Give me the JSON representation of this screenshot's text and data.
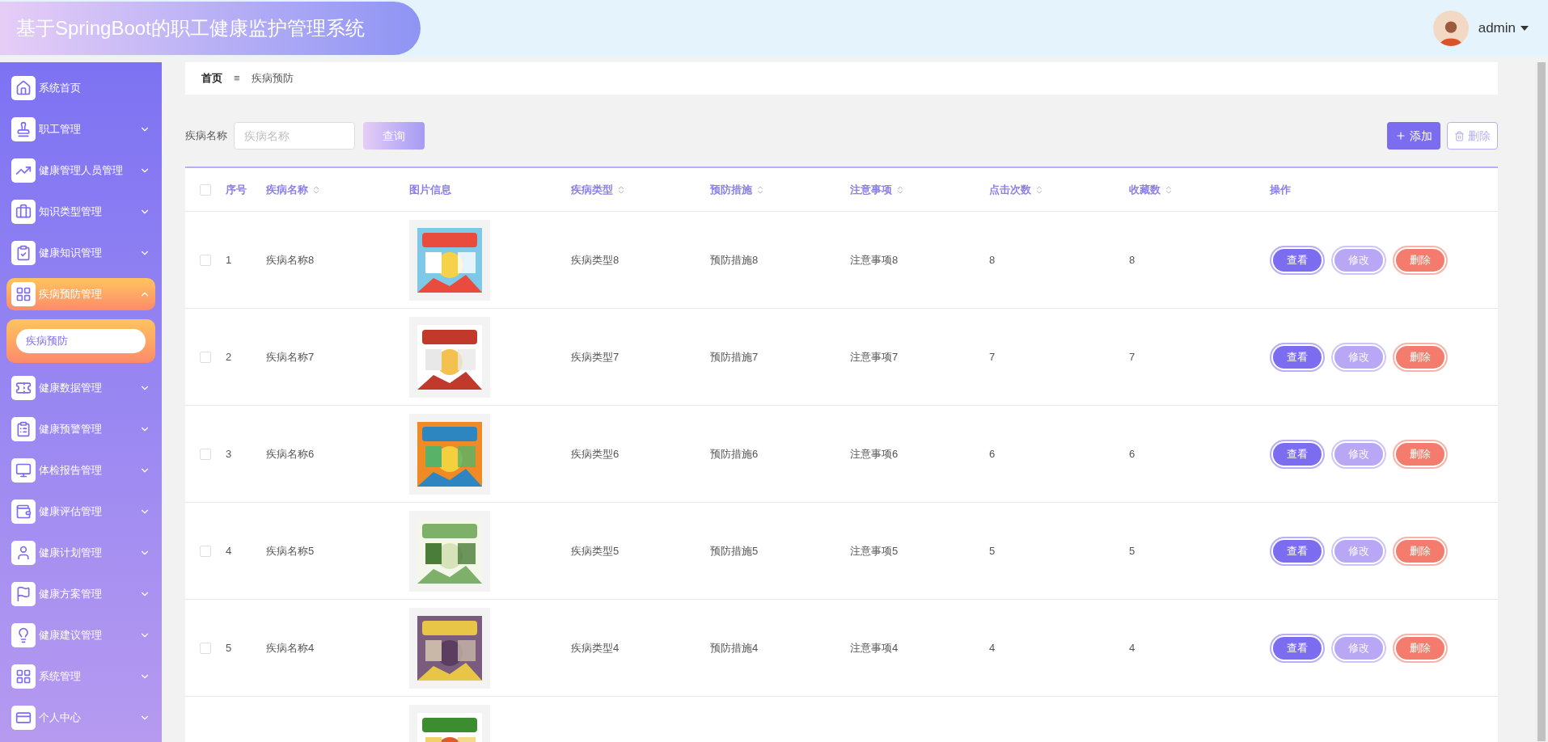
{
  "header": {
    "title": "基于SpringBoot的职工健康监护管理系统",
    "user": "admin"
  },
  "sidebar": {
    "items": [
      {
        "label": "系统首页",
        "kind": "link"
      },
      {
        "label": "职工管理",
        "kind": "menu",
        "expanded": false
      },
      {
        "label": "健康管理人员管理",
        "kind": "menu",
        "expanded": false
      },
      {
        "label": "知识类型管理",
        "kind": "menu",
        "expanded": false
      },
      {
        "label": "健康知识管理",
        "kind": "menu",
        "expanded": false
      },
      {
        "label": "疾病预防管理",
        "kind": "menu",
        "expanded": true,
        "children": [
          {
            "label": "疾病预防",
            "selected": true
          }
        ]
      },
      {
        "label": "健康数据管理",
        "kind": "menu",
        "expanded": false
      },
      {
        "label": "健康预警管理",
        "kind": "menu",
        "expanded": false
      },
      {
        "label": "体检报告管理",
        "kind": "menu",
        "expanded": false
      },
      {
        "label": "健康评估管理",
        "kind": "menu",
        "expanded": false
      },
      {
        "label": "健康计划管理",
        "kind": "menu",
        "expanded": false
      },
      {
        "label": "健康方案管理",
        "kind": "menu",
        "expanded": false
      },
      {
        "label": "健康建议管理",
        "kind": "menu",
        "expanded": false
      },
      {
        "label": "系统管理",
        "kind": "menu",
        "expanded": false
      },
      {
        "label": "个人中心",
        "kind": "menu",
        "expanded": false
      }
    ]
  },
  "breadcrumb": {
    "home": "首页",
    "separator": "≡",
    "current": "疾病预防"
  },
  "search": {
    "label": "疾病名称",
    "placeholder": "疾病名称",
    "button": "查询"
  },
  "actions": {
    "add": "添加",
    "delete": "删除"
  },
  "table": {
    "columns": [
      {
        "label": "序号",
        "sortable": false
      },
      {
        "label": "疾病名称",
        "sortable": true
      },
      {
        "label": "图片信息",
        "sortable": false
      },
      {
        "label": "疾病类型",
        "sortable": true
      },
      {
        "label": "预防措施",
        "sortable": true
      },
      {
        "label": "注意事项",
        "sortable": true
      },
      {
        "label": "点击次数",
        "sortable": true
      },
      {
        "label": "收藏数",
        "sortable": true
      },
      {
        "label": "操作",
        "sortable": false
      }
    ],
    "all_checked": false,
    "rows": [
      {
        "checked": false,
        "index": "1",
        "name": "疾病名称8",
        "image": {
          "kind": "picture"
        },
        "type": "疾病类型8",
        "measure": "预防措施8",
        "note": "注意事项8",
        "clicks": "8",
        "favorites": "8",
        "actions": [
          "查看",
          "修改",
          "删除"
        ]
      },
      {
        "checked": false,
        "index": "2",
        "name": "疾病名称7",
        "image": {
          "kind": "picture"
        },
        "type": "疾病类型7",
        "measure": "预防措施7",
        "note": "注意事项7",
        "clicks": "7",
        "favorites": "7",
        "actions": [
          "查看",
          "修改",
          "删除"
        ]
      },
      {
        "checked": false,
        "index": "3",
        "name": "疾病名称6",
        "image": {
          "kind": "picture"
        },
        "type": "疾病类型6",
        "measure": "预防措施6",
        "note": "注意事项6",
        "clicks": "6",
        "favorites": "6",
        "actions": [
          "查看",
          "修改",
          "删除"
        ]
      },
      {
        "checked": false,
        "index": "4",
        "name": "疾病名称5",
        "image": {
          "kind": "picture"
        },
        "type": "疾病类型5",
        "measure": "预防措施5",
        "note": "注意事项5",
        "clicks": "5",
        "favorites": "5",
        "actions": [
          "查看",
          "修改",
          "删除"
        ]
      },
      {
        "checked": false,
        "index": "5",
        "name": "疾病名称4",
        "image": {
          "kind": "picture"
        },
        "type": "疾病类型4",
        "measure": "预防措施4",
        "note": "注意事项4",
        "clicks": "4",
        "favorites": "4",
        "actions": [
          "查看",
          "修改",
          "删除"
        ]
      },
      {
        "image": {
          "kind": "picture"
        }
      }
    ]
  }
}
